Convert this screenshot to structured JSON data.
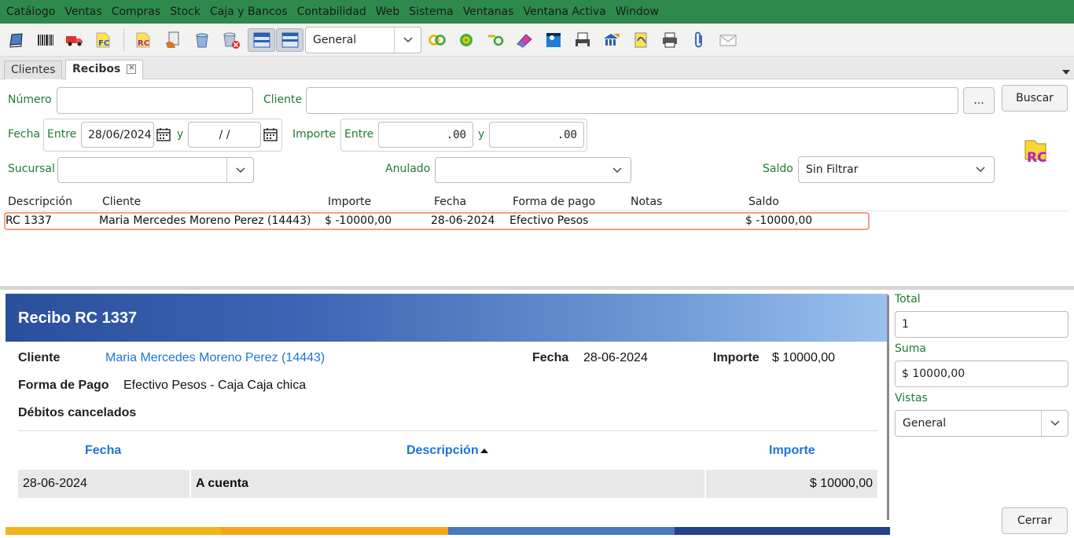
{
  "menu": [
    "Catálogo",
    "Ventas",
    "Compras",
    "Stock",
    "Caja y Bancos",
    "Contabilidad",
    "Web",
    "Sistema",
    "Ventanas",
    "Ventana Activa",
    "Window"
  ],
  "toolbar": {
    "combo_value": "General",
    "rc_label": "RC",
    "fc_label": "FC"
  },
  "tabs": [
    {
      "label": "Clientes"
    },
    {
      "label": "Recibos"
    }
  ],
  "filters": {
    "numero_label": "Número",
    "numero_value": "",
    "cliente_label": "Cliente",
    "cliente_value": "",
    "cliente_more": "...",
    "buscar": "Buscar",
    "fecha_label": "Fecha",
    "entre1": "Entre",
    "fecha_desde": "28/06/2024",
    "y1": "y",
    "fecha_hasta": " /  /",
    "importe_label": "Importe",
    "entre2": "Entre",
    "importe_desde": ".00",
    "y2": "y",
    "importe_hasta": ".00",
    "sucursal_label": "Sucursal",
    "sucursal_value": "",
    "anulado_label": "Anulado",
    "anulado_value": "",
    "saldo_label": "Saldo",
    "saldo_value": "Sin Filtrar",
    "badge": "RC"
  },
  "grid": {
    "headers": [
      "Descripción",
      "Cliente",
      "Importe",
      "Fecha",
      "Forma de pago",
      "Notas",
      "Saldo"
    ],
    "rows": [
      [
        "RC 1337",
        "Maria Mercedes Moreno Perez (14443)",
        "$ -10000,00",
        "28-06-2024",
        "Efectivo Pesos",
        "",
        "$ -10000,00"
      ]
    ]
  },
  "receipt": {
    "title": "Recibo RC 1337",
    "cliente_label": "Cliente",
    "cliente_value": "Maria Mercedes Moreno Perez (14443)",
    "fecha_label": "Fecha",
    "fecha_value": "28-06-2024",
    "importe_label": "Importe",
    "importe_value": "$ 10000,00",
    "forma_label": "Forma de Pago",
    "forma_value": "Efectivo Pesos - Caja Caja chica",
    "debitos_label": "Débitos cancelados",
    "table_headers": [
      "Fecha",
      "Descripción",
      "Importe"
    ],
    "table_rows": [
      [
        "28-06-2024",
        "A cuenta",
        "$ 10000,00"
      ]
    ]
  },
  "side": {
    "total_label": "Total",
    "total_value": "1",
    "suma_label": "Suma",
    "suma_value": "$ 10000,00",
    "vistas_label": "Vistas",
    "vistas_value": "General",
    "cerrar": "Cerrar"
  },
  "colors": {
    "menubar": "#2e8a4c",
    "label_green": "#1f7a35",
    "link_blue": "#1e74d4",
    "banner": "#2a4f9c",
    "selection": "#f0a080"
  }
}
